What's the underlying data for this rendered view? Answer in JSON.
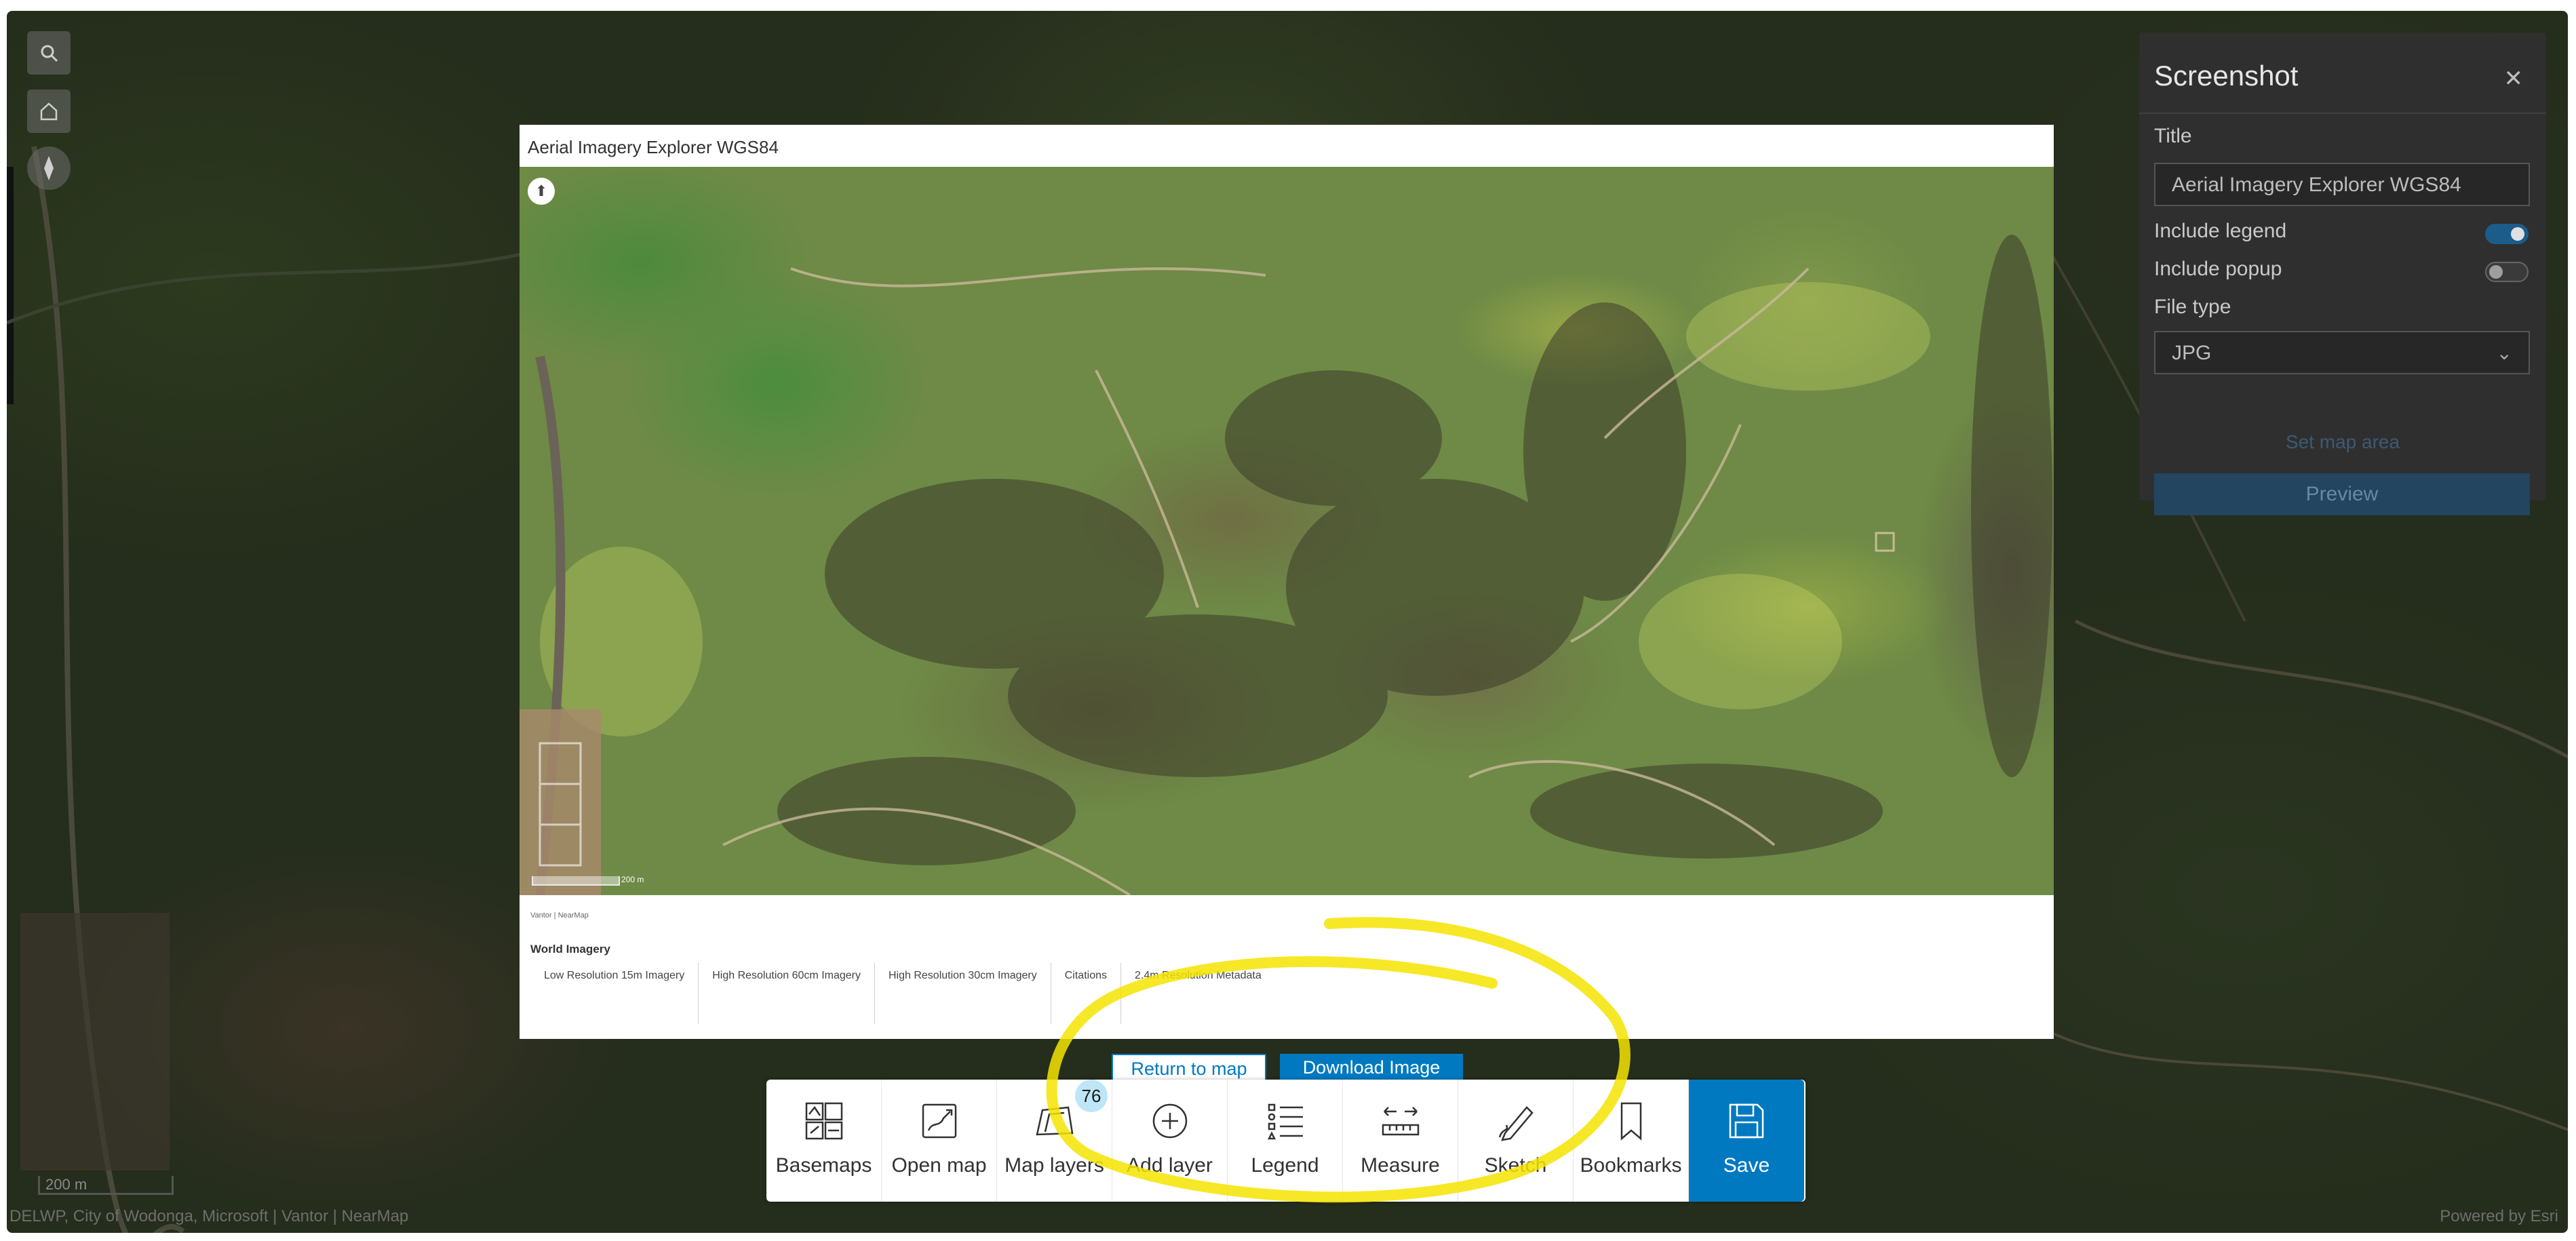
{
  "map": {
    "scale_label": "200 m",
    "attribution": "DELWP, City of Wodonga, Microsoft | Vantor | NearMap",
    "powered_by": "Powered by Esri"
  },
  "panel": {
    "title": "Screenshot",
    "title_label": "Title",
    "title_value": "Aerial Imagery Explorer WGS84",
    "include_legend": "Include legend",
    "include_legend_on": true,
    "include_popup": "Include popup",
    "include_popup_on": false,
    "file_type_label": "File type",
    "file_type_value": "JPG",
    "set_map_area": "Set map area",
    "preview": "Preview"
  },
  "preview": {
    "title": "Aerial Imagery Explorer WGS84",
    "scale_label": "200 m",
    "attribution": "Vantor | NearMap",
    "legend_title": "World Imagery",
    "legend_items": [
      "Low Resolution 15m Imagery",
      "High Resolution 60cm Imagery",
      "High Resolution 30cm Imagery",
      "Citations",
      "2.4m Resolution Metadata"
    ],
    "return_label": "Return to map",
    "download_label": "Download Image"
  },
  "toolbar": {
    "items": [
      {
        "label": "Basemaps",
        "icon": "basemaps-icon"
      },
      {
        "label": "Open map",
        "icon": "open-map-icon"
      },
      {
        "label": "Map layers",
        "icon": "map-layers-icon",
        "badge": "76"
      },
      {
        "label": "Add layer",
        "icon": "add-layer-icon"
      },
      {
        "label": "Legend",
        "icon": "legend-icon"
      },
      {
        "label": "Measure",
        "icon": "measure-icon"
      },
      {
        "label": "Sketch",
        "icon": "sketch-icon"
      },
      {
        "label": "Bookmarks",
        "icon": "bookmark-icon"
      },
      {
        "label": "Save",
        "icon": "save-icon"
      }
    ]
  },
  "colors": {
    "accent": "#0079c1",
    "annotation": "#f5e400"
  }
}
